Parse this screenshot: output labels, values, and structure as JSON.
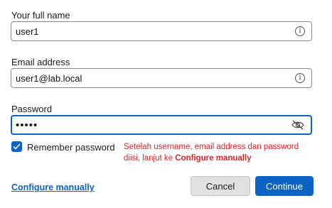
{
  "form": {
    "name": {
      "label": "Your full name",
      "value": "user1"
    },
    "email": {
      "label": "Email address",
      "value": "user1@lab.local"
    },
    "password": {
      "label": "Password",
      "value": "•••••"
    },
    "remember": {
      "label": "Remember password",
      "checked": true
    }
  },
  "annotation": {
    "text_part1": "Setelah username, email address dan password diisi, lanjut ke ",
    "text_bold": "Configure manually"
  },
  "footer": {
    "configure_link": "Configure manually",
    "cancel_label": "Cancel",
    "continue_label": "Continue"
  },
  "colors": {
    "accent": "#0b63c4",
    "annotation": "#d9232a"
  }
}
